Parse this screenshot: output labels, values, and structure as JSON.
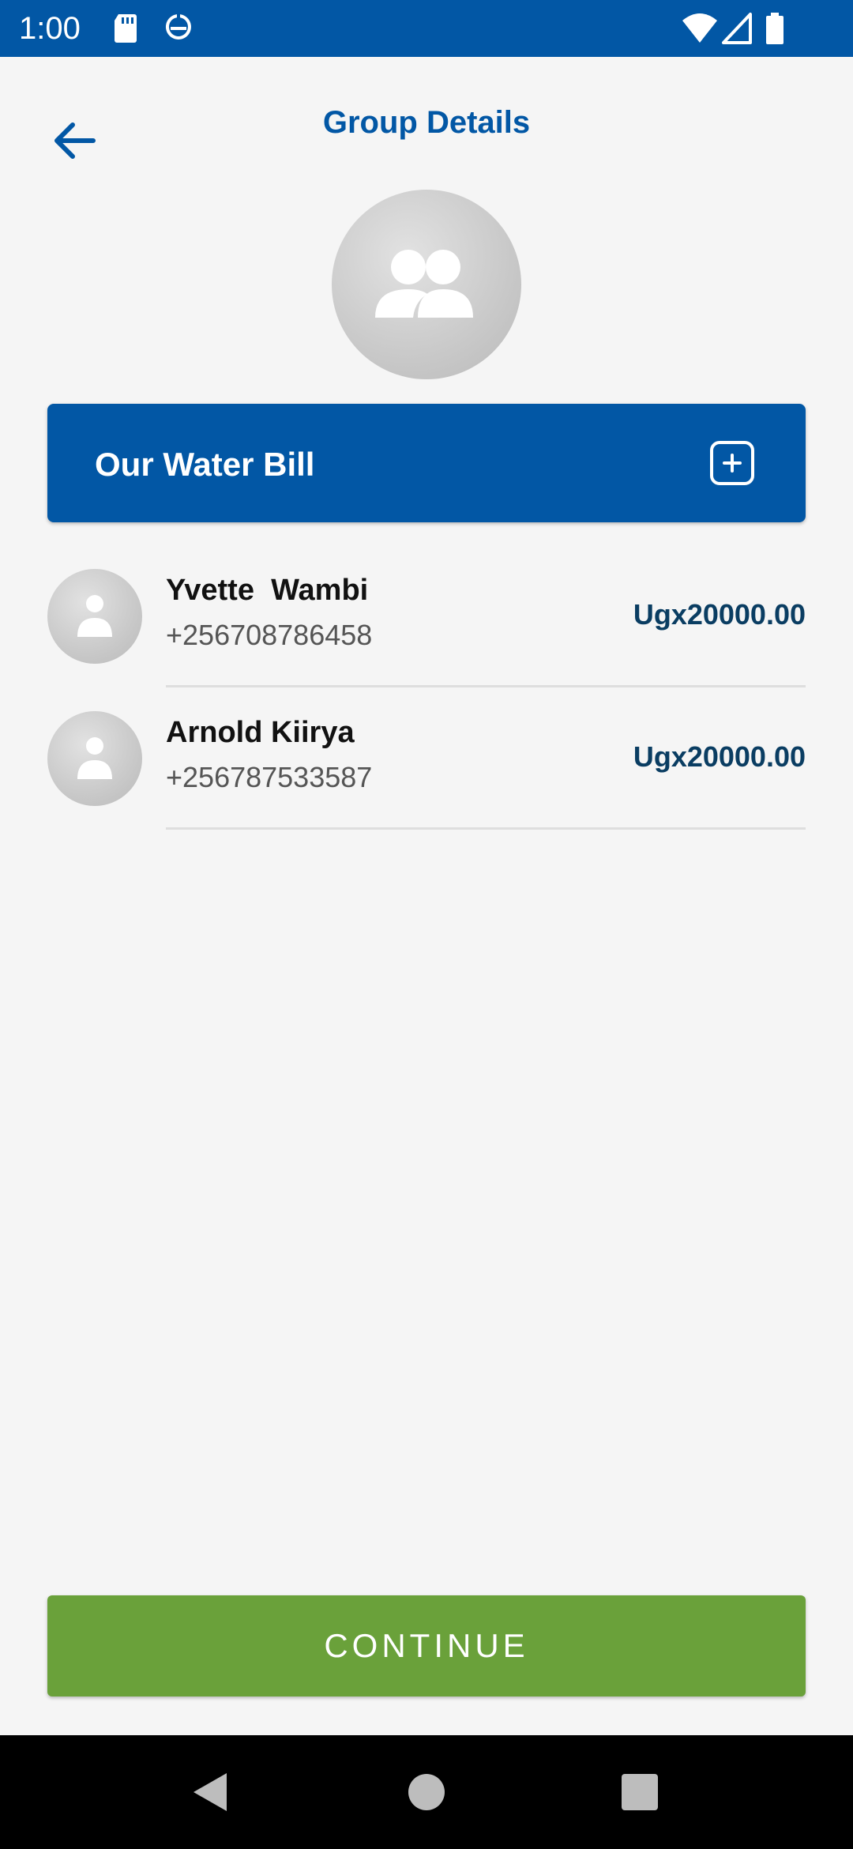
{
  "status_bar": {
    "time": "1:00",
    "icons": [
      "sd-card-icon",
      "data-saver-icon",
      "wifi-icon",
      "cell-signal-icon",
      "battery-icon"
    ]
  },
  "header": {
    "title": "Group Details",
    "back_icon": "back-arrow-icon"
  },
  "group": {
    "avatar_icon": "group-people-icon",
    "name": "Our Water Bill",
    "add_icon": "add-member-icon"
  },
  "members": [
    {
      "name": "Yvette  Wambi",
      "phone": "+256708786458",
      "amount": "Ugx20000.00"
    },
    {
      "name": "Arnold Kiirya",
      "phone": "+256787533587",
      "amount": "Ugx20000.00"
    }
  ],
  "actions": {
    "continue_label": "CONTINUE"
  },
  "nav_bar": {
    "icons": [
      "back-triangle-icon",
      "home-circle-icon",
      "recents-square-icon"
    ]
  },
  "colors": {
    "primary": "#0257a5",
    "accent": "#6aa13a",
    "amount": "#0a3d62",
    "background": "#f5f5f5"
  }
}
